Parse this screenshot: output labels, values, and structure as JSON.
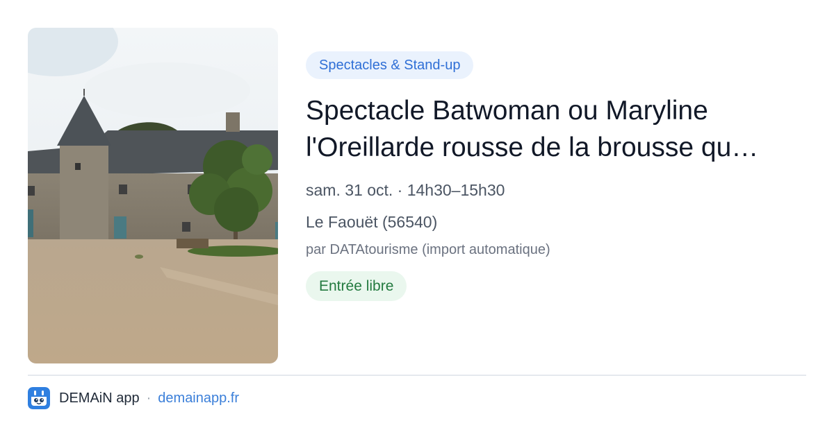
{
  "event": {
    "category": "Spectacles & Stand-up",
    "title": "Spectacle Batwoman ou Maryline l'Oreillarde rousse de la brousse qu…",
    "datetime": "sam. 31 oct. · 14h30–15h30",
    "location": "Le Faouët (56540)",
    "source": "par DATAtourisme (import automatique)",
    "price": "Entrée libre"
  },
  "footer": {
    "app_name": "DEMAiN app",
    "separator": "·",
    "domain": "demainapp.fr"
  },
  "icons": {
    "app_icon": "demain-app-icon"
  },
  "colors": {
    "category_bg": "#eaf2fd",
    "category_text": "#2f6fd6",
    "price_bg": "#eaf7ee",
    "price_text": "#237a3f",
    "link": "#3b7fd9"
  }
}
